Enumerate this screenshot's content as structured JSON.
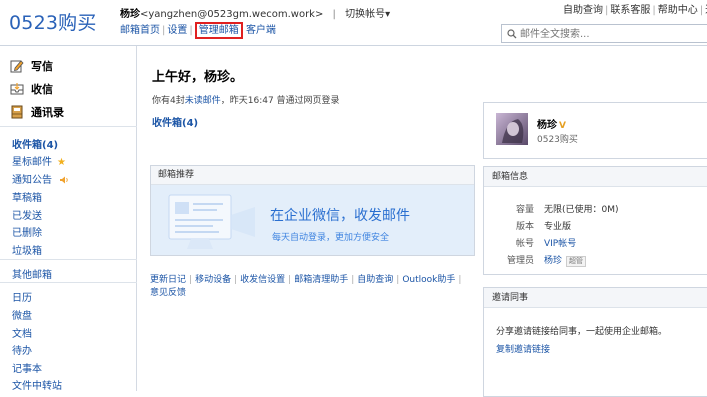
{
  "header": {
    "logo": "0523购买",
    "user_name": "杨珍",
    "user_email": "<yangzhen@0523gm.wecom.work>",
    "separator": "|",
    "switch_account": "切换帐号▾",
    "links": {
      "mailbox_home": "邮箱首页",
      "settings": "设置",
      "manage_mailbox": "管理邮箱",
      "client": "客户端"
    },
    "top_right": {
      "self_service": "自助查询",
      "contact_support": "联系客服",
      "help_center": "帮助中心",
      "logout": "退"
    },
    "search_placeholder": "邮件全文搜索..."
  },
  "sidebar": {
    "commands": {
      "compose": "写信",
      "receive": "收信",
      "contacts": "通讯录"
    },
    "folders": {
      "inbox": "收件箱(4)",
      "starred": "星标邮件",
      "notices": "通知公告",
      "drafts": "草稿箱",
      "sent": "已发送",
      "deleted": "已删除",
      "spam": "垃圾箱"
    },
    "other_mailboxes": "其他邮箱",
    "tools": {
      "calendar": "日历",
      "weiban": "微盘",
      "docs": "文档",
      "todo": "待办",
      "notes": "记事本",
      "file_transfer": "文件中转站"
    },
    "icons": {
      "compose": "pencil-icon",
      "receive": "inbox-icon",
      "contacts": "address-book-icon",
      "starred": "star-icon",
      "notices": "speaker-icon"
    }
  },
  "main": {
    "greeting": "上午好，杨珍。",
    "unread": {
      "prefix": "你有4封",
      "unread_link": "未读邮件",
      "suffix": "，昨天16:47 曾通过网页登录"
    },
    "inbox_link": "收件箱(4)",
    "recommend": {
      "header": "邮箱推荐",
      "title": "在企业微信，收发邮件",
      "subtitle": "每天自动登录，更加方便安全"
    },
    "bottom_links": {
      "changelog": "更新日记",
      "mobile": "移动设备",
      "send_receive_settings": "收发信设置",
      "cleanup": "邮箱清理助手",
      "self_service": "自助查询",
      "outlook": "Outlook助手",
      "feedback": "意见反馈"
    }
  },
  "right": {
    "profile": {
      "name": "杨珍",
      "vip_mark": "V",
      "org": "0523购买"
    },
    "info": {
      "header": "邮箱信息",
      "capacity_label": "容量",
      "capacity_value": "无限(已使用：0M)",
      "version_label": "版本",
      "version_value": "专业版",
      "account_label": "帐号",
      "account_value": "VIP帐号",
      "admin_label": "管理员",
      "admin_value": "杨珍",
      "admin_tag": "超管"
    },
    "invite": {
      "header": "邀请同事",
      "text": "分享邀请链接给同事，一起使用企业邮箱。",
      "copy_link": "复制邀请链接"
    }
  },
  "colors": {
    "link_blue": "#1c55a6",
    "logo_blue": "#2a62b8",
    "highlight_red": "#e02020",
    "banner_bg": "#e3eefa"
  }
}
